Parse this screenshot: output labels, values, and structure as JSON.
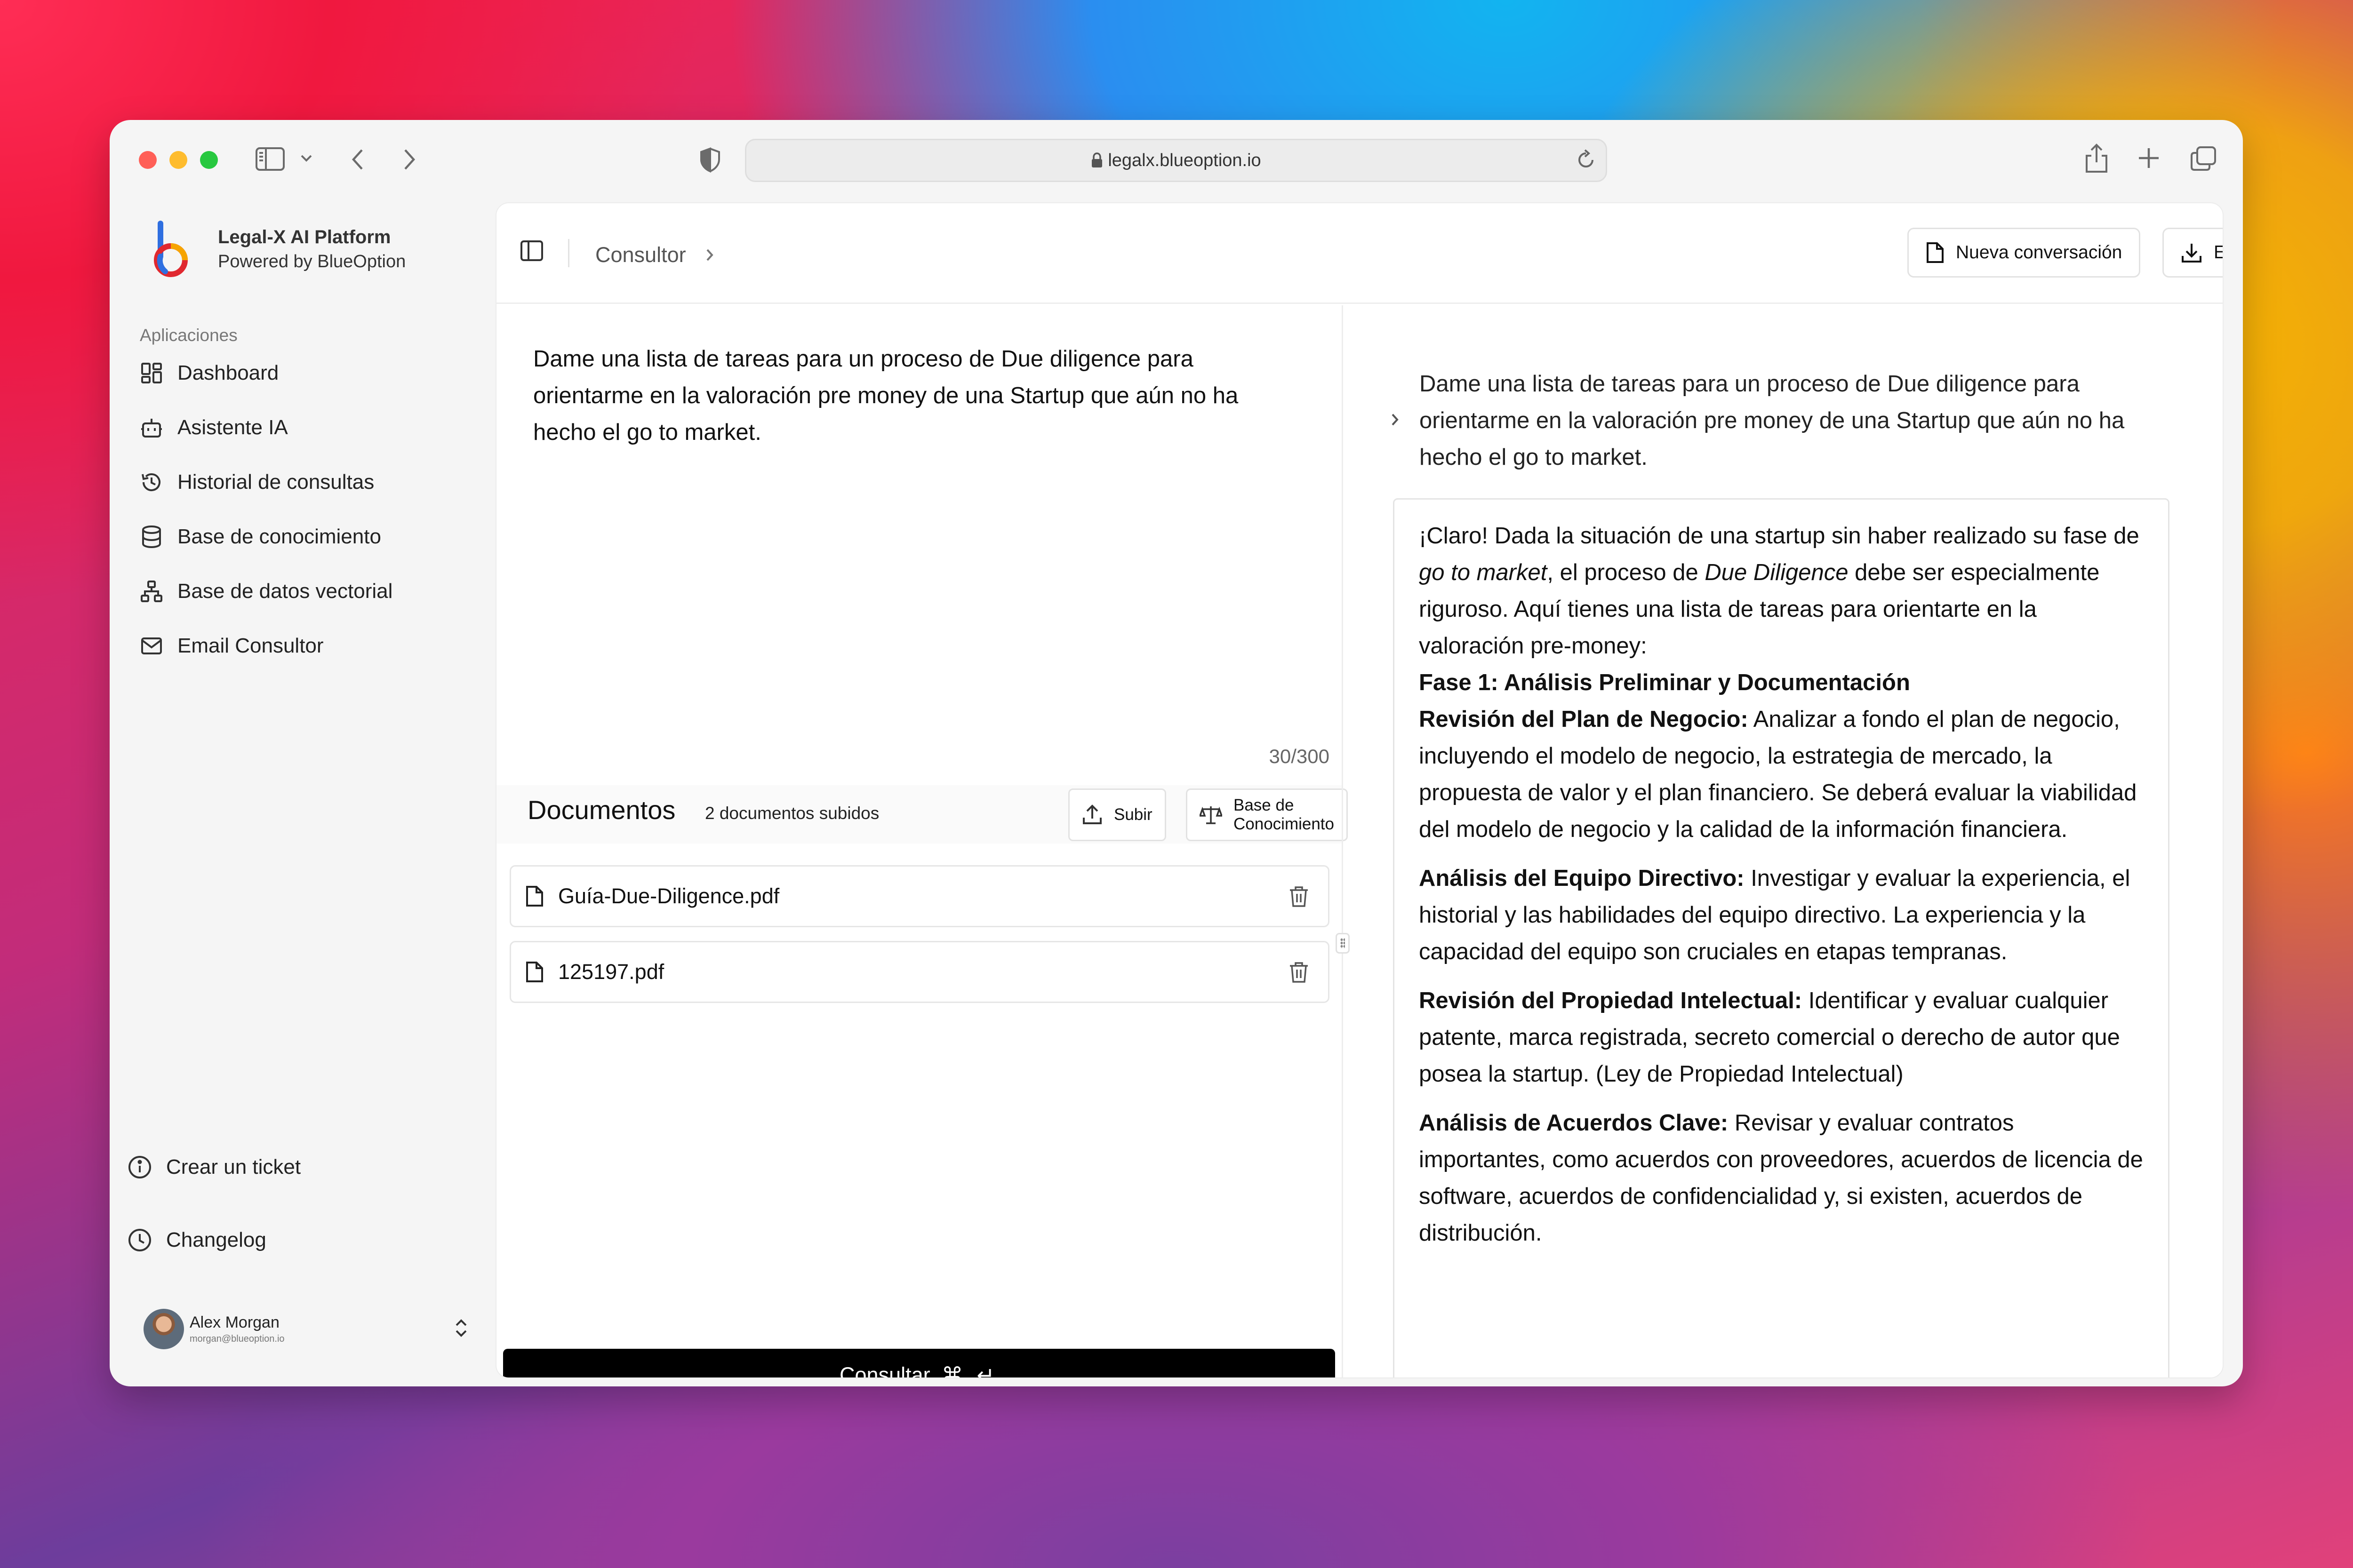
{
  "browser": {
    "url": "legalx.blueoption.io"
  },
  "brand": {
    "name": "Legal-X AI Platform",
    "tagline": "Powered by BlueOption"
  },
  "sidebar": {
    "section_label": "Aplicaciones",
    "items": [
      {
        "label": "Dashboard",
        "icon": "dashboard-grid-icon"
      },
      {
        "label": "Asistente IA",
        "icon": "robot-icon"
      },
      {
        "label": "Historial de consultas",
        "icon": "history-icon"
      },
      {
        "label": "Base de conocimiento",
        "icon": "database-icon"
      },
      {
        "label": "Base de datos vectorial",
        "icon": "network-icon"
      },
      {
        "label": "Email Consultor",
        "icon": "mail-icon"
      }
    ],
    "ticket_label": "Crear un ticket",
    "changelog_label": "Changelog",
    "user": {
      "name": "Alex Morgan",
      "email": "morgan@blueoption.io"
    }
  },
  "header": {
    "breadcrumb": "Consultor",
    "new_conversation_label": "Nueva conversación",
    "export_label": "Exportar"
  },
  "composer": {
    "prompt": "Dame una lista de tareas para un proceso de Due diligence para orientarme en la valoración pre money de una Startup que aún no ha hecho el go to market.",
    "counter": "30/300",
    "submit_label": "Consultar",
    "submit_shortcut": "⌘ ↵"
  },
  "documents": {
    "title": "Documentos",
    "count_label": "2 documentos subidos",
    "upload_label": "Subir",
    "knowledge_label": "Base de Conocimiento",
    "files": [
      {
        "name": "Guía-Due-Diligence.pdf"
      },
      {
        "name": "125197.pdf"
      }
    ]
  },
  "conversation": {
    "question": "Dame una lista de tareas para un proceso de Due diligence para orientarme en la valoración pre money de una Startup que aún no ha hecho el go to market.",
    "answer": {
      "intro_1": "¡Claro! Dada la situación de una startup sin haber realizado su fase de ",
      "intro_em_1": "go to market",
      "intro_2": ", el proceso de ",
      "intro_em_2": "Due Diligence",
      "intro_3": " debe ser especialmente riguroso. Aquí tienes una lista de tareas para orientarte en la valoración pre-money:",
      "phase_title": "Fase 1: Análisis Preliminar y Documentación",
      "items": [
        {
          "title": "Revisión del Plan de Negocio:",
          "text": " Analizar a fondo el plan de negocio, incluyendo el modelo de negocio, la estrategia de mercado, la propuesta de valor y el plan financiero. Se deberá evaluar la viabilidad del modelo de negocio y la calidad de la información financiera."
        },
        {
          "title": "Análisis del Equipo Directivo:",
          "text": " Investigar y evaluar la experiencia, el historial y las habilidades del equipo directivo. La experiencia y la capacidad del equipo son cruciales en etapas tempranas."
        },
        {
          "title": "Revisión del Propiedad Intelectual:",
          "text": " Identificar y evaluar cualquier patente, marca registrada, secreto comercial o derecho de autor que posea la startup. (Ley de Propiedad Intelectual)"
        },
        {
          "title": "Análisis de Acuerdos Clave:",
          "text": " Revisar y evaluar contratos importantes, como acuerdos con proveedores, acuerdos de licencia de software, acuerdos de confidencialidad y, si existen, acuerdos de distribución."
        }
      ]
    }
  }
}
